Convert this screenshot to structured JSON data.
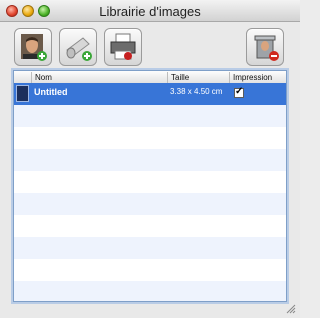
{
  "window": {
    "title": "Librairie d'images"
  },
  "toolbar": {
    "buttons": [
      {
        "icon": "add-person-photo-icon"
      },
      {
        "icon": "add-from-scanner-icon"
      },
      {
        "icon": "print-icon"
      },
      {
        "icon": "trash-icon"
      }
    ]
  },
  "table": {
    "columns": [
      "",
      "Nom",
      "Taille",
      "Impression"
    ],
    "rows": [
      {
        "name": "Untitled",
        "size": "3.38 x 4.50 cm",
        "print": true,
        "checkmark": "✓"
      }
    ]
  },
  "colors": {
    "selection": "#3875d7",
    "stripe": "#eef3fd"
  }
}
